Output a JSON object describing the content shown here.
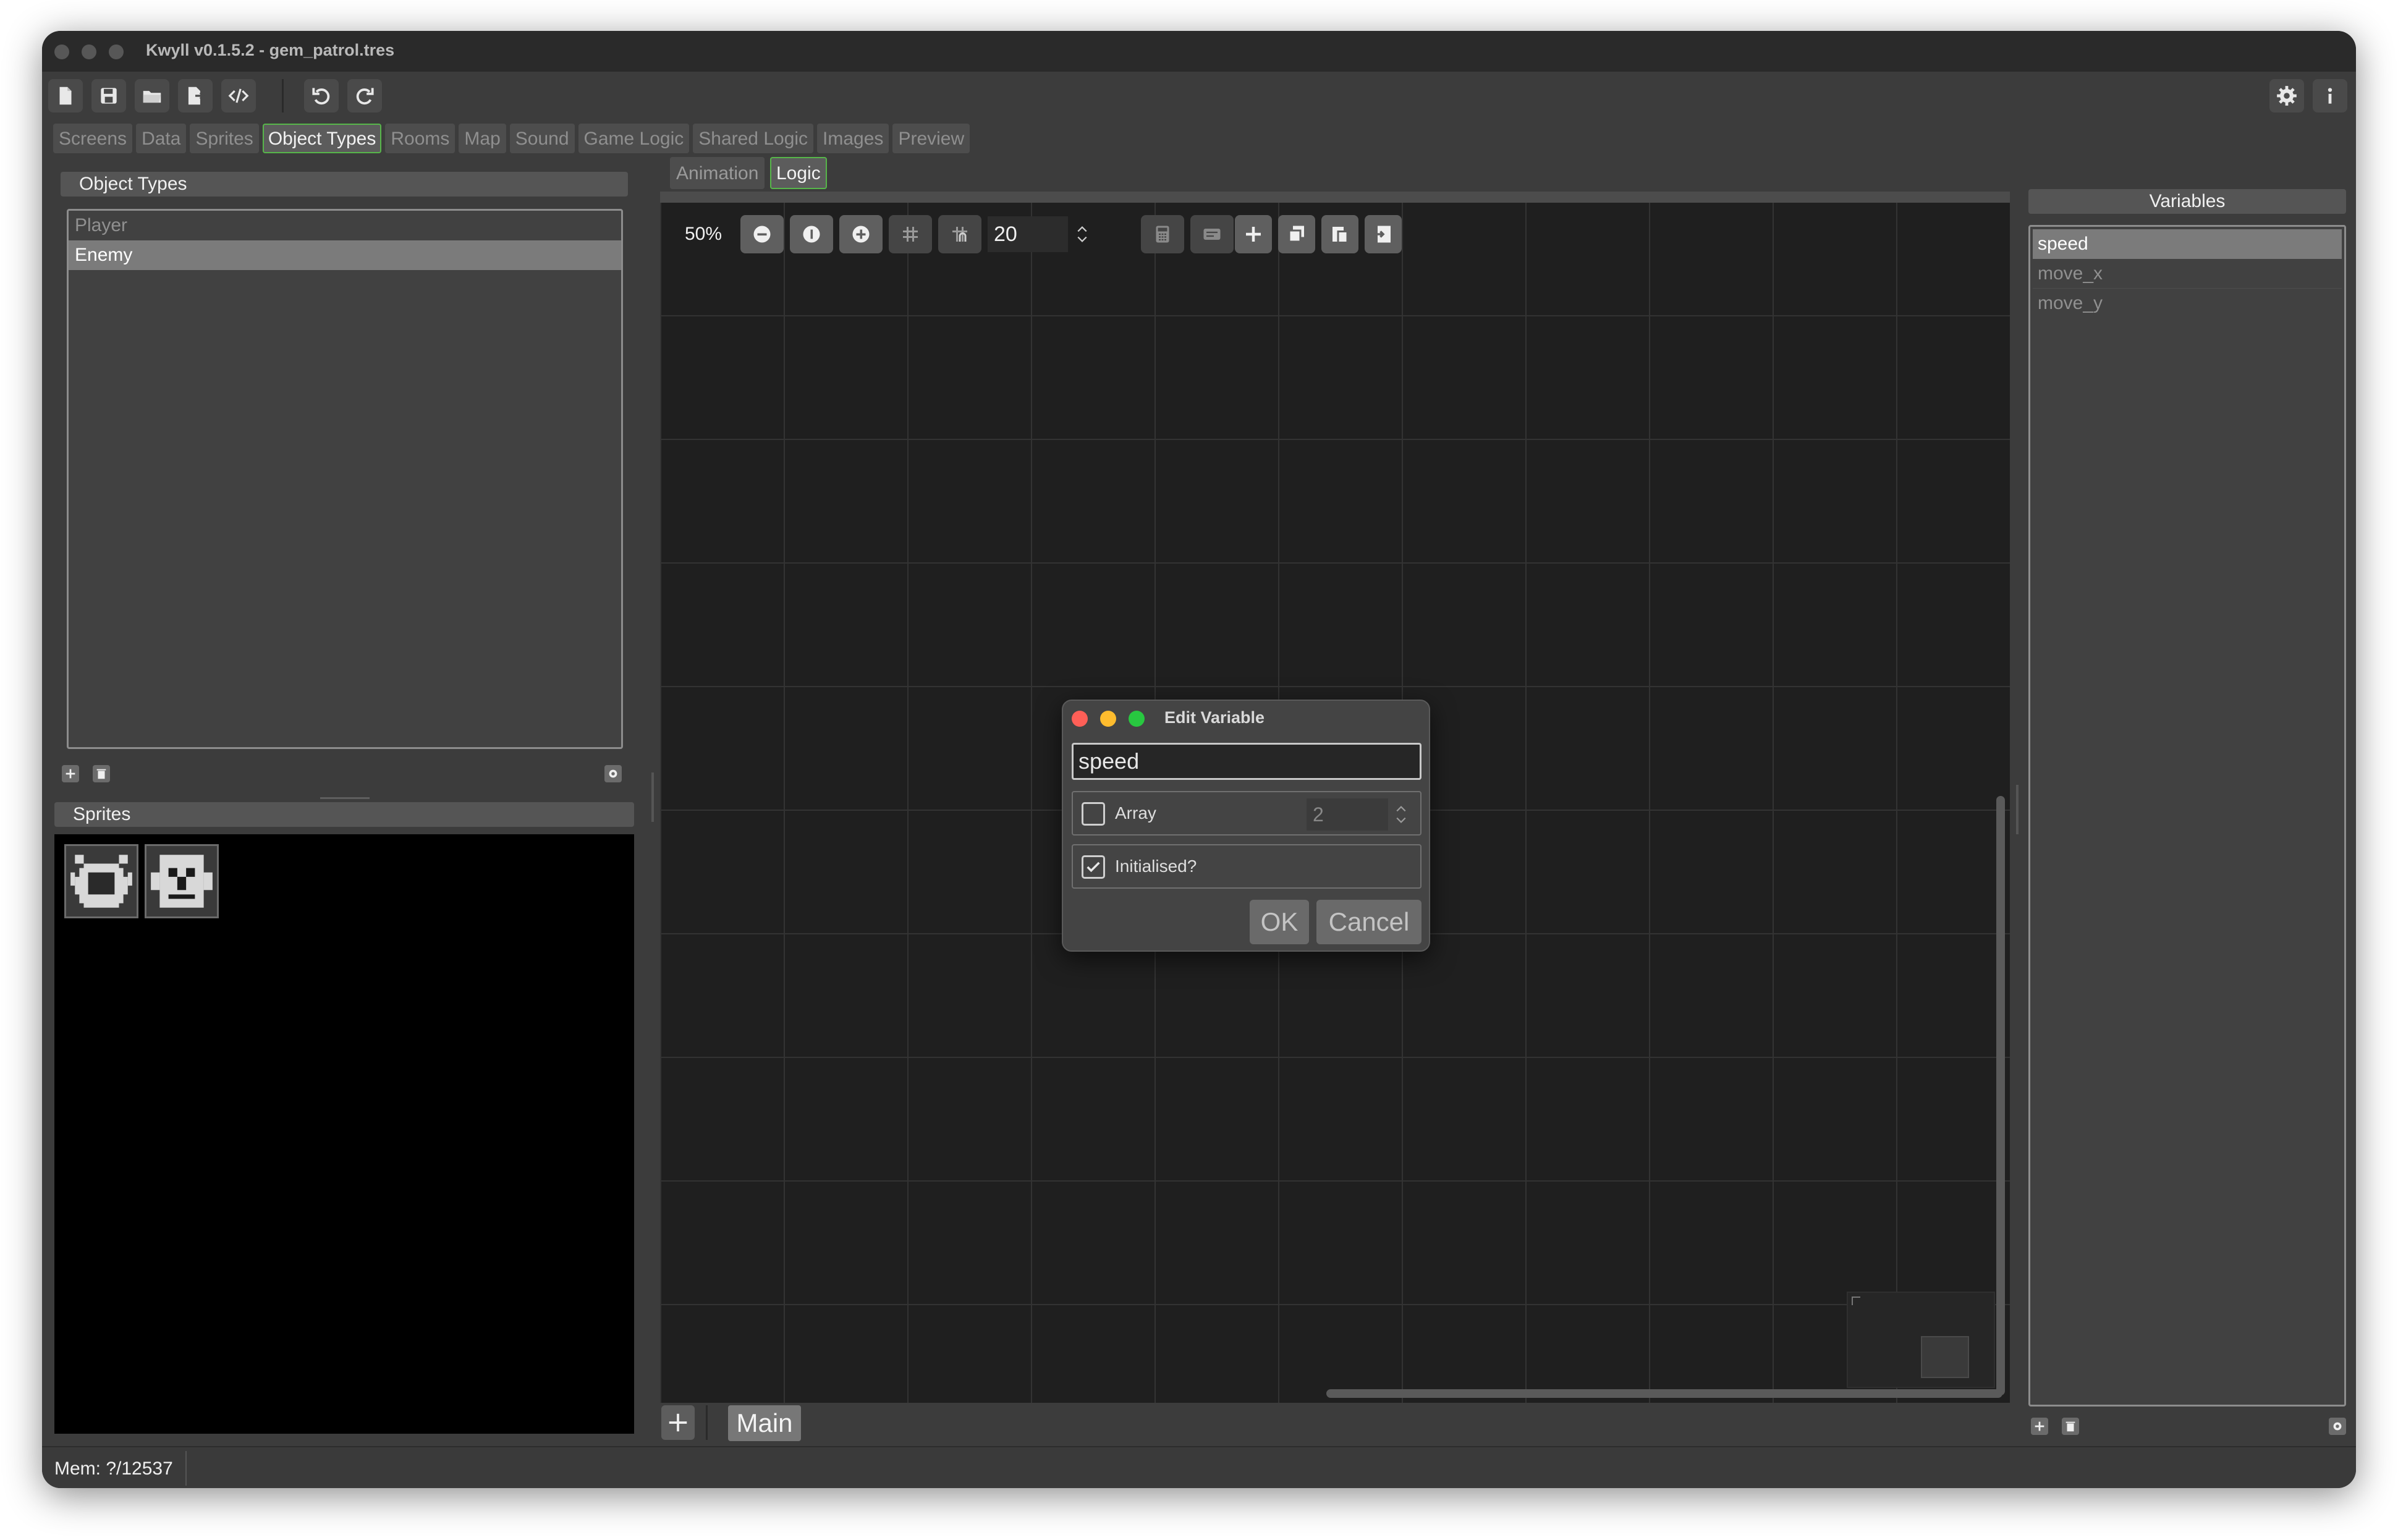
{
  "window": {
    "title": "Kwyll v0.1.5.2 - gem_patrol.tres"
  },
  "main_tabs": [
    "Screens",
    "Data",
    "Sprites",
    "Object Types",
    "Rooms",
    "Map",
    "Sound",
    "Game Logic",
    "Shared Logic",
    "Images",
    "Preview"
  ],
  "active_main_tab": "Object Types",
  "object_types": {
    "header": "Object Types",
    "items": [
      "Player",
      "Enemy"
    ],
    "selected": "Enemy"
  },
  "sprites": {
    "header": "Sprites",
    "count": 2
  },
  "editor": {
    "subtabs": [
      "Animation",
      "Logic"
    ],
    "active_subtab": "Logic",
    "zoom": "50%",
    "grid_size": "20",
    "bottom_tab": "Main"
  },
  "variables": {
    "header": "Variables",
    "items": [
      "speed",
      "move_x",
      "move_y"
    ],
    "selected": "speed"
  },
  "dialog": {
    "title": "Edit Variable",
    "name_value": "speed",
    "array_label": "Array",
    "array_checked": false,
    "array_size": "2",
    "initialised_label": "Initialised?",
    "initialised_checked": true,
    "ok_label": "OK",
    "cancel_label": "Cancel"
  },
  "status": {
    "memory": "Mem: ?/12537"
  },
  "colors": {
    "active_tab_border": "#57b64a",
    "close_dot": "#ff5f57",
    "minimize_dot": "#febc2e",
    "zoom_dot": "#28c840"
  }
}
